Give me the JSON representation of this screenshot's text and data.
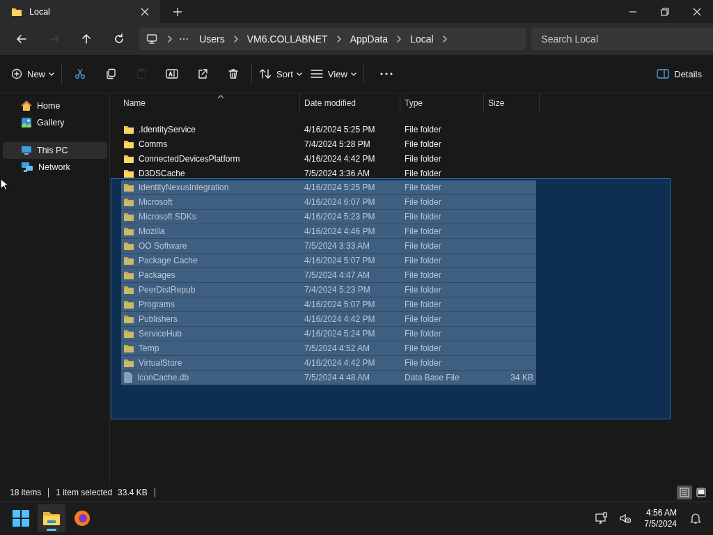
{
  "window": {
    "tab_title": "Local"
  },
  "navigation": [
    {
      "kind": "back",
      "disabled": false
    },
    {
      "kind": "forward",
      "disabled": true
    },
    {
      "kind": "up",
      "disabled": false
    },
    {
      "kind": "refresh",
      "disabled": false
    }
  ],
  "breadcrumb": [
    "Users",
    "VM6.COLLABNET",
    "AppData",
    "Local"
  ],
  "search": {
    "placeholder": "Search Local"
  },
  "toolbar": [
    {
      "kind": "new",
      "label": "New",
      "disabled": false
    },
    {
      "kind": "cut",
      "disabled": false
    },
    {
      "kind": "copy",
      "disabled": false
    },
    {
      "kind": "paste",
      "disabled": true
    },
    {
      "kind": "rename",
      "disabled": false
    },
    {
      "kind": "share",
      "disabled": false
    },
    {
      "kind": "delete",
      "disabled": false
    },
    {
      "kind": "sort",
      "label": "Sort",
      "disabled": false
    },
    {
      "kind": "view",
      "label": "View",
      "disabled": false
    },
    {
      "kind": "more",
      "disabled": false
    },
    {
      "kind": "details",
      "label": "Details",
      "disabled": false
    }
  ],
  "sidebar": {
    "items": [
      {
        "kind": "home",
        "label": "Home",
        "selected": false
      },
      {
        "kind": "gallery",
        "label": "Gallery",
        "selected": false
      },
      {
        "kind": "pc",
        "label": "This PC",
        "selected": true
      },
      {
        "kind": "network",
        "label": "Network",
        "selected": false
      }
    ]
  },
  "table": {
    "columns": [
      {
        "label": "Name",
        "sorted": true
      },
      {
        "label": "Date modified",
        "sorted": false
      },
      {
        "label": "Type",
        "sorted": false
      },
      {
        "label": "Size",
        "sorted": false
      }
    ],
    "rows": [
      {
        "kind": "folder",
        "name": ".IdentityService",
        "date": "4/16/2024 5:25 PM",
        "type": "File folder",
        "selected": false
      },
      {
        "kind": "folder",
        "name": "Comms",
        "date": "7/4/2024 5:28 PM",
        "type": "File folder",
        "selected": false
      },
      {
        "kind": "folder",
        "name": "ConnectedDevicesPlatform",
        "date": "4/16/2024 4:42 PM",
        "type": "File folder",
        "selected": false
      },
      {
        "kind": "folder",
        "name": "D3DSCache",
        "date": "7/5/2024 3:36 AM",
        "type": "File folder",
        "selected": false
      },
      {
        "kind": "folder",
        "name": "IdentityNexusIntegration",
        "date": "4/16/2024 5:25 PM",
        "type": "File folder",
        "selected": true
      },
      {
        "kind": "folder",
        "name": "Microsoft",
        "date": "4/16/2024 6:07 PM",
        "type": "File folder",
        "selected": true
      },
      {
        "kind": "folder",
        "name": "Microsoft SDKs",
        "date": "4/16/2024 5:23 PM",
        "type": "File folder",
        "selected": true
      },
      {
        "kind": "folder",
        "name": "Mozilla",
        "date": "4/16/2024 4:46 PM",
        "type": "File folder",
        "selected": true
      },
      {
        "kind": "folder",
        "name": "OO Software",
        "date": "7/5/2024 3:33 AM",
        "type": "File folder",
        "selected": true
      },
      {
        "kind": "folder",
        "name": "Package Cache",
        "date": "4/16/2024 5:07 PM",
        "type": "File folder",
        "selected": true
      },
      {
        "kind": "folder",
        "name": "Packages",
        "date": "7/5/2024 4:47 AM",
        "type": "File folder",
        "selected": true
      },
      {
        "kind": "folder",
        "name": "PeerDistRepub",
        "date": "7/4/2024 5:23 PM",
        "type": "File folder",
        "selected": true
      },
      {
        "kind": "folder",
        "name": "Programs",
        "date": "4/16/2024 5:07 PM",
        "type": "File folder",
        "selected": true
      },
      {
        "kind": "folder",
        "name": "Publishers",
        "date": "4/16/2024 4:42 PM",
        "type": "File folder",
        "selected": true
      },
      {
        "kind": "folder",
        "name": "ServiceHub",
        "date": "4/16/2024 5:24 PM",
        "type": "File folder",
        "selected": true
      },
      {
        "kind": "folder",
        "name": "Temp",
        "date": "7/5/2024 4:52 AM",
        "type": "File folder",
        "selected": true
      },
      {
        "kind": "folder",
        "name": "VirtualStore",
        "date": "4/16/2024 4:42 PM",
        "type": "File folder",
        "selected": true
      },
      {
        "kind": "file",
        "name": "IconCache.db",
        "date": "7/5/2024 4:48 AM",
        "type": "Data Base File",
        "size": "34 KB",
        "selected": true
      }
    ]
  },
  "status_bar": {
    "item_count": "18 items",
    "selection": "1 item selected",
    "selection_size": "33.4 KB",
    "views": [
      {
        "kind": "details",
        "selected": true
      },
      {
        "kind": "tiles",
        "selected": false
      }
    ]
  },
  "taskbar": {
    "apps": [
      {
        "kind": "start",
        "active": false
      },
      {
        "kind": "explorer",
        "active": true
      },
      {
        "kind": "browser",
        "active": false
      }
    ],
    "time": "4:56 AM",
    "date": "7/5/2024"
  }
}
